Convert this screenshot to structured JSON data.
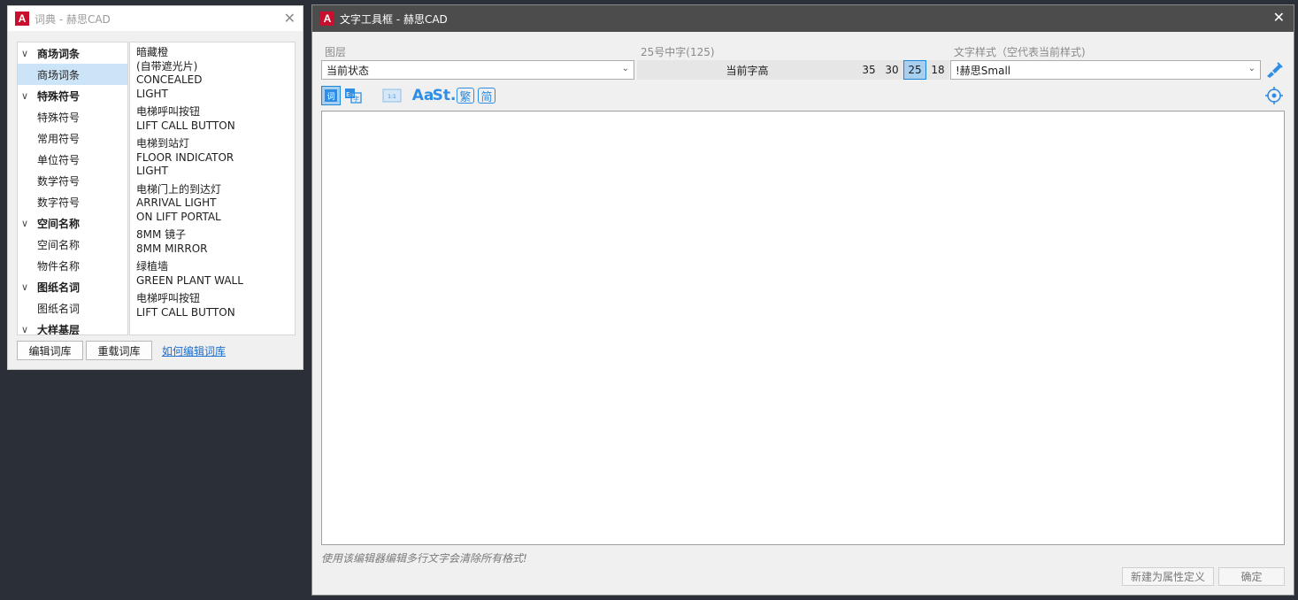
{
  "dict_window": {
    "title": "词典 - 赫思CAD",
    "logo_letter": "A",
    "close_symbol": "✕",
    "tree": [
      {
        "type": "group",
        "label": "商场词条",
        "expanded": true
      },
      {
        "type": "leaf",
        "label": "商场词条",
        "selected": true
      },
      {
        "type": "group",
        "label": "特殊符号",
        "expanded": true
      },
      {
        "type": "leaf",
        "label": "特殊符号"
      },
      {
        "type": "leaf",
        "label": "常用符号"
      },
      {
        "type": "leaf",
        "label": "单位符号"
      },
      {
        "type": "leaf",
        "label": "数学符号"
      },
      {
        "type": "leaf",
        "label": "数字符号"
      },
      {
        "type": "group",
        "label": "空间名称",
        "expanded": true
      },
      {
        "type": "leaf",
        "label": "空间名称"
      },
      {
        "type": "leaf",
        "label": "物件名称"
      },
      {
        "type": "group",
        "label": "图纸名词",
        "expanded": true
      },
      {
        "type": "leaf",
        "label": "图纸名词"
      },
      {
        "type": "group",
        "label": "大样基层",
        "expanded": true
      }
    ],
    "entries": [
      [
        "暗藏橙",
        "(自带遮光片)",
        "CONCEALED",
        "LIGHT"
      ],
      [
        "电梯呼叫按钮",
        "LIFT CALL BUTTON"
      ],
      [
        "电梯到站灯",
        "FLOOR INDICATOR",
        "LIGHT"
      ],
      [
        "电梯门上的到达灯",
        "ARRIVAL LIGHT",
        "ON LIFT PORTAL"
      ],
      [
        "8MM 镜子",
        "8MM MIRROR"
      ],
      [
        "绿植墙",
        "GREEN PLANT WALL"
      ],
      [
        "电梯呼叫按钮",
        "LIFT CALL BUTTON"
      ]
    ],
    "buttons": {
      "edit_library": "编辑词库",
      "reload_library": "重载词库",
      "how_to_edit": "如何编辑词库"
    }
  },
  "tool_window": {
    "title": "文字工具框 - 赫思CAD",
    "logo_letter": "A",
    "close_symbol": "✕",
    "layer": {
      "label": "图层",
      "value": "当前状态"
    },
    "size": {
      "label": "25号中字(125)",
      "current_label": "当前字高",
      "options": [
        "35",
        "30",
        "25",
        "18"
      ],
      "selected": "25"
    },
    "style": {
      "label": "文字样式（空代表当前样式)",
      "value": "!赫思Small"
    },
    "toolbar": {
      "aa_label": "Aa",
      "st_label": "St.",
      "traditional_label": "繁",
      "simplified_label": "简"
    },
    "editor_text": "",
    "note": "使用该编辑器编辑多行文字会清除所有格式!",
    "buttons": {
      "new_attr_def": "新建为属性定义",
      "ok": "确定"
    },
    "colors": {
      "accent": "#2f8de4",
      "titlebar": "#4c4c4c",
      "selection": "#cce4f7"
    }
  }
}
